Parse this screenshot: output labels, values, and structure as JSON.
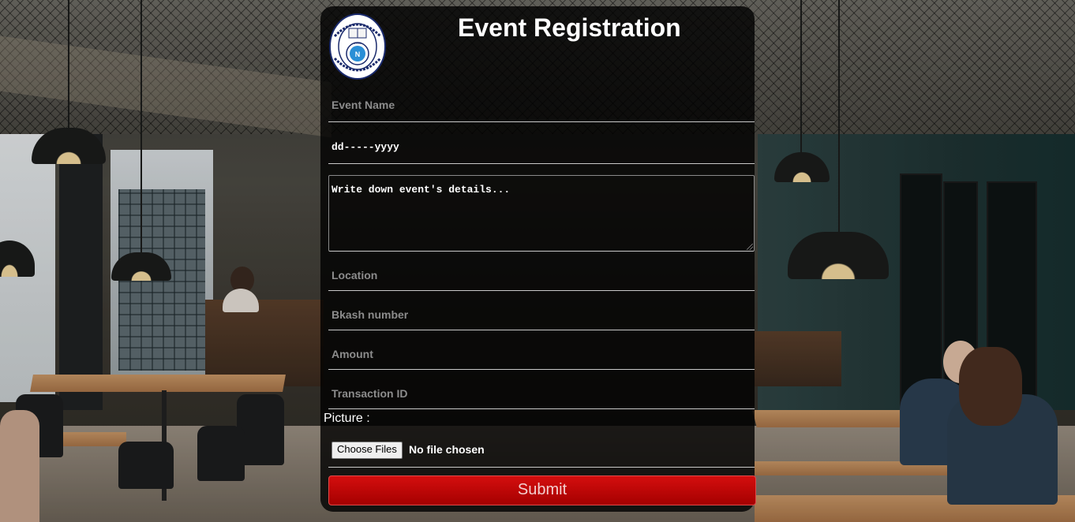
{
  "page": {
    "title": "Event Registration"
  },
  "logo": {
    "name": "north-south-university-seal",
    "top_text": "SEEK KNOWLEDGE",
    "bottom_text": "NORTH SOUTH UNIVERSITY",
    "center_text": "NSU"
  },
  "form": {
    "event_name_placeholder": "Event Name",
    "date_placeholder": "dd-----yyyy",
    "details_placeholder": "Write down event's details...",
    "location_placeholder": "Location",
    "bkash_placeholder": "Bkash number",
    "amount_placeholder": "Amount",
    "transaction_placeholder": "Transaction ID",
    "picture_label": "Picture :",
    "file_button_label": "Choose Files",
    "file_status": "No file chosen",
    "submit_label": "Submit"
  },
  "colors": {
    "card_background": "#000000cc",
    "submit_button": "#c00000",
    "placeholder_text": "#8c8c8c",
    "underline": "#c9c9c9"
  }
}
